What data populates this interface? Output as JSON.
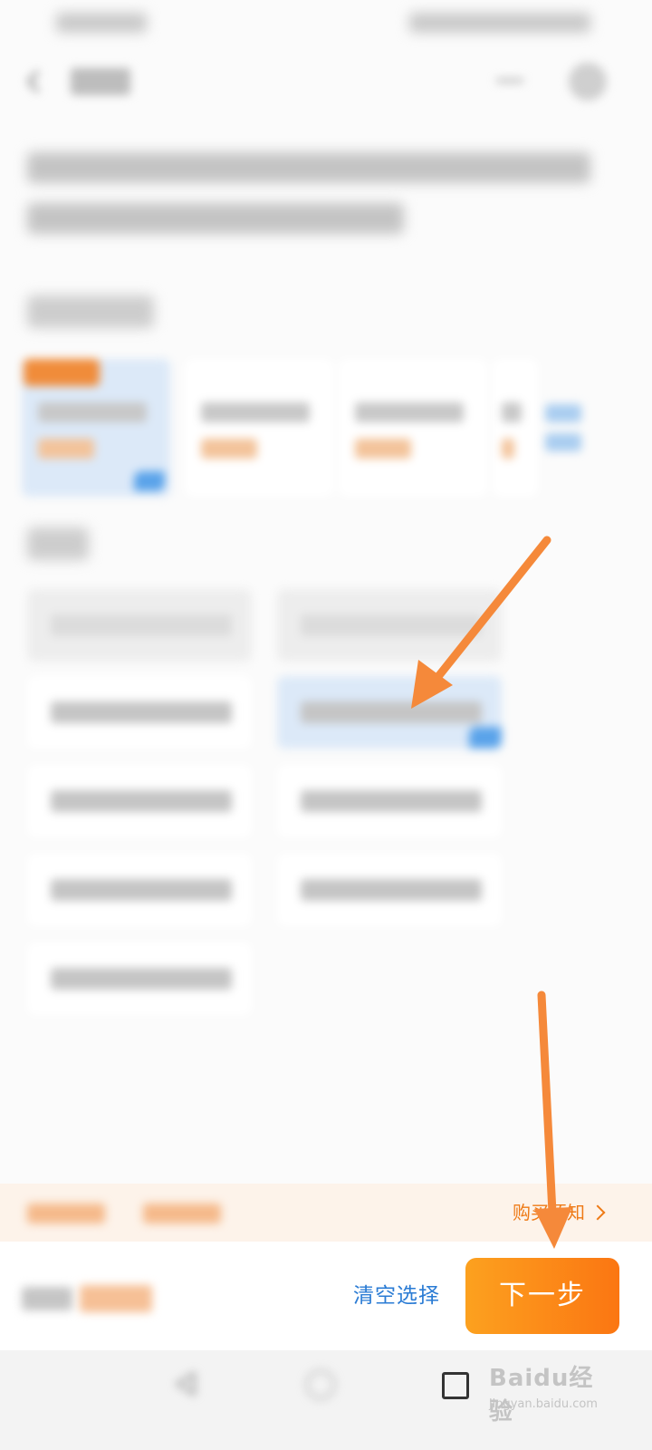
{
  "icons": {
    "back": "back-icon",
    "more": "more-icon",
    "close": "close-icon",
    "check": "check-corner-icon",
    "chevron": "chevron-right-icon",
    "nav_back": "nav-back-icon",
    "nav_home": "nav-home-icon",
    "nav_recent": "nav-recent-icon"
  },
  "colors": {
    "accent_orange": "#fb7612",
    "accent_orange_start": "#fca11f",
    "link_blue": "#2a7bd4",
    "selected_bg": "#dce9f8",
    "notice_bg": "#fdf3ea",
    "annotation_arrow": "#f5893a"
  },
  "notice_bar": {
    "purchase_notice": "购买须知"
  },
  "action_bar": {
    "clear_selection": "清空选择",
    "next_step": "下一步"
  },
  "watermark": {
    "logo": "Baidu经验",
    "url": "jingyan.baidu.com"
  }
}
